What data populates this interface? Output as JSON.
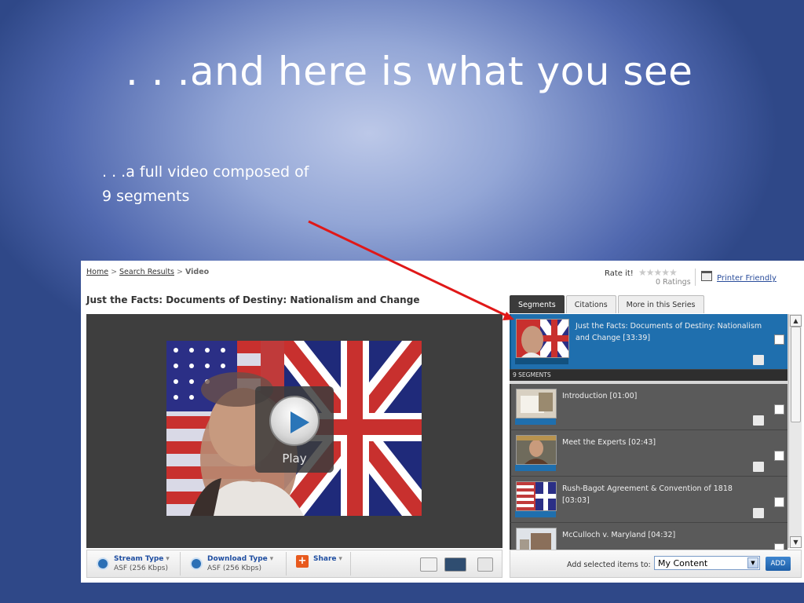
{
  "slide": {
    "title": ". . .and here is what you see",
    "subtitle_line1": ". . .a full video composed of",
    "subtitle_line2": "9 segments"
  },
  "breadcrumb": {
    "home": "Home",
    "sep": ">",
    "search_results": "Search Results",
    "current": "Video"
  },
  "video_title": "Just the Facts: Documents of Destiny: Nationalism and Change",
  "rating": {
    "label": "Rate it!",
    "stars": "★★★★★",
    "count": "0 Ratings"
  },
  "printer_friendly": "Printer Friendly",
  "tabs": [
    {
      "label": "Segments",
      "active": true
    },
    {
      "label": "Citations",
      "active": false
    },
    {
      "label": "More in this Series",
      "active": false
    }
  ],
  "player": {
    "play_label": "Play"
  },
  "controls": {
    "stream": {
      "label": "Stream Type",
      "sub": "ASF (256 Kbps)"
    },
    "download": {
      "label": "Download Type",
      "sub": "ASF (256 Kbps)"
    },
    "share": {
      "label": "Share"
    },
    "dropdown_glyph": "▾"
  },
  "segments": {
    "header": "9 SEGMENTS",
    "full": {
      "title": "Just the Facts: Documents of Destiny: Nationalism and Change [33:39]"
    },
    "items": [
      {
        "title": "Introduction [01:00]"
      },
      {
        "title": "Meet the Experts [02:43]"
      },
      {
        "title": "Rush-Bagot Agreement & Convention of 1818 [03:03]"
      },
      {
        "title": "McCulloch v. Maryland [04:32]"
      }
    ]
  },
  "add_bar": {
    "label": "Add selected items to:",
    "selected": "My Content",
    "button": "ADD"
  },
  "colors": {
    "arrow": "#e01818",
    "selected_segment": "#1f6fae",
    "link": "#2a4d9b"
  }
}
